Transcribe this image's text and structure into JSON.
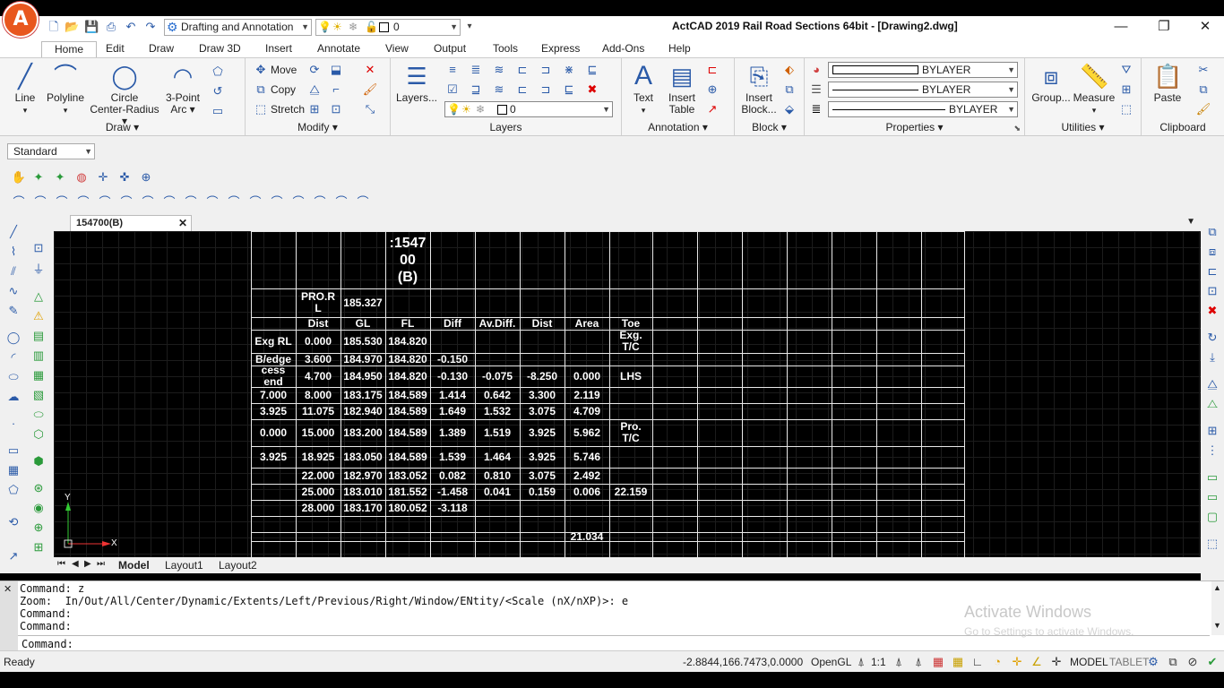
{
  "app": {
    "logo_letter": "A",
    "title": "ActCAD 2019 Rail Road Sections 64bit - [Drawing2.dwg]",
    "workspace": "Drafting and Annotation",
    "quick_layer": "0"
  },
  "menu": [
    "Home",
    "Edit",
    "Draw",
    "Draw 3D",
    "Insert",
    "Annotate",
    "View",
    "Output",
    "Tools",
    "Express",
    "Add-Ons",
    "Help"
  ],
  "ribbon": {
    "draw": {
      "title": "Draw ▾",
      "line": "Line",
      "polyline": "Polyline",
      "circle": "Circle",
      "circle_sub": "Center-Radius",
      "arc": "3-Point",
      "arc_sub": "Arc"
    },
    "modify": {
      "title": "Modify ▾",
      "move": "Move",
      "copy": "Copy",
      "stretch": "Stretch"
    },
    "layers": {
      "title": "Layers",
      "button": "Layers...",
      "current": "0"
    },
    "annotation": {
      "title": "Annotation ▾",
      "text": "Text",
      "table": "Insert",
      "table_sub": "Table"
    },
    "block": {
      "title": "Block ▾",
      "insert": "Insert",
      "insert_sub": "Block..."
    },
    "properties": {
      "title": "Properties ▾",
      "color": "BYLAYER",
      "linetype": "BYLAYER",
      "lineweight": "BYLAYER"
    },
    "utilities": {
      "title": "Utilities ▾",
      "group": "Group...",
      "measure": "Measure"
    },
    "clipboard": {
      "title": "Clipboard",
      "paste": "Paste"
    }
  },
  "style_box": "Standard",
  "document_tab": "154700(B)",
  "table": {
    "title": ":1547\n00\n(B)",
    "pro_label": "PRO.R\nL",
    "pro_value": "185.327",
    "headers": [
      "Dist",
      "GL",
      "FL",
      "Diff",
      "Av.Diff.",
      "Dist",
      "Area",
      "Toe"
    ],
    "rows": [
      [
        "Exg RL",
        "0.000",
        "185.530",
        "184.820",
        "",
        "",
        "",
        "",
        "Exg.\nT/C"
      ],
      [
        "B/edge",
        "3.600",
        "184.970",
        "184.820",
        "-0.150",
        "",
        "",
        "",
        ""
      ],
      [
        "cess\nend",
        "4.700",
        "184.950",
        "184.820",
        "-0.130",
        "-0.075",
        "-8.250",
        "0.000",
        "LHS"
      ],
      [
        "7.000",
        "8.000",
        "183.175",
        "184.589",
        "1.414",
        "0.642",
        "3.300",
        "2.119",
        ""
      ],
      [
        "3.925",
        "11.075",
        "182.940",
        "184.589",
        "1.649",
        "1.532",
        "3.075",
        "4.709",
        ""
      ],
      [
        "0.000",
        "15.000",
        "183.200",
        "184.589",
        "1.389",
        "1.519",
        "3.925",
        "5.962",
        "Pro.\nT/C"
      ],
      [
        "3.925",
        "18.925",
        "183.050",
        "184.589",
        "1.539",
        "1.464",
        "3.925",
        "5.746",
        ""
      ],
      [
        "",
        "22.000",
        "182.970",
        "183.052",
        "0.082",
        "0.810",
        "3.075",
        "2.492",
        ""
      ],
      [
        "",
        "25.000",
        "183.010",
        "181.552",
        "-1.458",
        "0.041",
        "0.159",
        "0.006",
        "22.159"
      ],
      [
        "",
        "28.000",
        "183.170",
        "180.052",
        "-3.118",
        "",
        "",
        "",
        ""
      ],
      [
        "",
        "",
        "",
        "",
        "",
        "",
        "",
        "",
        ""
      ],
      [
        "",
        "",
        "",
        "",
        "",
        "",
        "",
        "21.034",
        ""
      ]
    ]
  },
  "ucs": {
    "x": "X",
    "y": "Y"
  },
  "layout_tabs": [
    "Model",
    "Layout1",
    "Layout2"
  ],
  "command": {
    "lines": [
      "Command: z",
      "Zoom:  In/Out/All/Center/Dynamic/Extents/Left/Previous/Right/Window/ENtity/<Scale (nX/nXP)>: e",
      "Command:",
      "Command:"
    ],
    "prompt": "Command:"
  },
  "watermark": {
    "title": "Activate Windows",
    "subtitle": "Go to Settings to activate Windows."
  },
  "status": {
    "ready": "Ready",
    "coords": "-2.8844,166.7473,0.0000",
    "renderer": "OpenGL",
    "scale": "1:1",
    "model": "MODEL",
    "tablet": "TABLET"
  }
}
